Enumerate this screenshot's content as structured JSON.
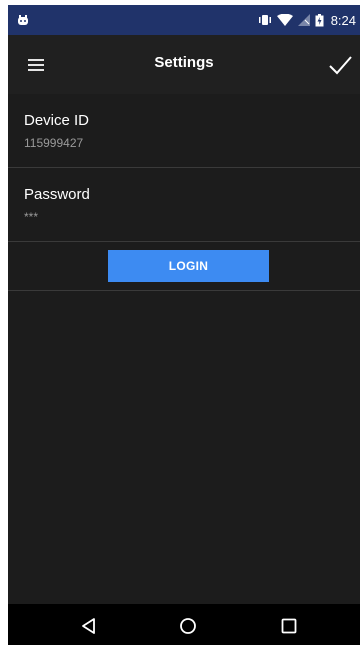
{
  "status_bar": {
    "time": "8:24",
    "icons": [
      "android-icon",
      "vibrate-icon",
      "wifi-icon",
      "no-signal-icon",
      "battery-icon"
    ]
  },
  "app_bar": {
    "title": "Settings",
    "menu_icon": "hamburger-menu-icon",
    "confirm_icon": "checkmark-icon"
  },
  "settings": {
    "device_id": {
      "label": "Device ID",
      "value": "115999427"
    },
    "password": {
      "label": "Password",
      "value": "***"
    }
  },
  "login_button": {
    "label": "LOGIN"
  },
  "nav_bar": {
    "icons": [
      "back-icon",
      "home-icon",
      "recents-icon"
    ]
  },
  "colors": {
    "status_bar": "#20336a",
    "app_bar": "#202020",
    "background": "#1c1c1c",
    "accent": "#3d8bf2",
    "divider": "#3a3a3a"
  }
}
